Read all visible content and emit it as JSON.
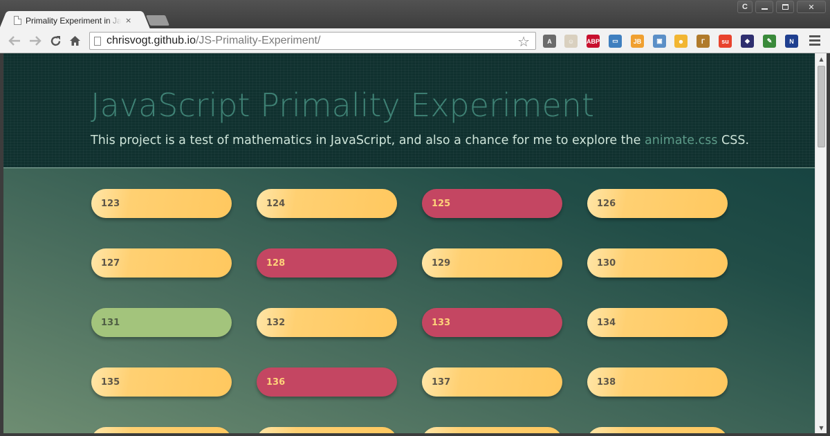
{
  "browser": {
    "tab_title": "Primality Experiment in Ja",
    "tab_close": "×",
    "url_host": "chrisvogt.github.io",
    "url_path": "/JS-Primality-Experiment/",
    "window_user": "C",
    "window_close": "✕",
    "extensions": [
      {
        "name": "angular-icon",
        "label": "A",
        "color": "#6b6b6b"
      },
      {
        "name": "face-icon",
        "label": "☺",
        "color": "#d9d0bf"
      },
      {
        "name": "adblock-icon",
        "label": "ABP",
        "color": "#c8102e"
      },
      {
        "name": "folder-icon",
        "label": "▭",
        "color": "#3f7fbf"
      },
      {
        "name": "jetbrains-icon",
        "label": "JB",
        "color": "#f0a030"
      },
      {
        "name": "window-icon",
        "label": "▣",
        "color": "#5b8fc7"
      },
      {
        "name": "emoji-icon",
        "label": "☻",
        "color": "#f2b632"
      },
      {
        "name": "ruler-icon",
        "label": "Г",
        "color": "#b07a2a"
      },
      {
        "name": "stumbleupon-icon",
        "label": "su",
        "color": "#e8432d"
      },
      {
        "name": "colorpick-icon",
        "label": "◆",
        "color": "#2f2f6f"
      },
      {
        "name": "eyedropper-icon",
        "label": "✎",
        "color": "#3a8a3a"
      },
      {
        "name": "selection-icon",
        "label": "N",
        "color": "#1f3f8f"
      }
    ]
  },
  "hero": {
    "title": "JavaScript Primality Experiment",
    "subtitle_before": "This project is a test of mathematics in JavaScript, and also a chance for me to explore the ",
    "subtitle_link": "animate.css",
    "subtitle_after": " CSS."
  },
  "colors": {
    "composite": "#ffc85f",
    "prime": "#a3c47c",
    "highlight": "#c44662"
  },
  "numbers": [
    {
      "value": "123",
      "kind": "composite"
    },
    {
      "value": "124",
      "kind": "composite"
    },
    {
      "value": "125",
      "kind": "square"
    },
    {
      "value": "126",
      "kind": "composite"
    },
    {
      "value": "127",
      "kind": "composite"
    },
    {
      "value": "128",
      "kind": "square"
    },
    {
      "value": "129",
      "kind": "composite"
    },
    {
      "value": "130",
      "kind": "composite"
    },
    {
      "value": "131",
      "kind": "prime"
    },
    {
      "value": "132",
      "kind": "composite"
    },
    {
      "value": "133",
      "kind": "square"
    },
    {
      "value": "134",
      "kind": "composite"
    },
    {
      "value": "135",
      "kind": "composite"
    },
    {
      "value": "136",
      "kind": "square"
    },
    {
      "value": "137",
      "kind": "composite"
    },
    {
      "value": "138",
      "kind": "composite"
    },
    {
      "value": "",
      "kind": "composite"
    },
    {
      "value": "",
      "kind": "composite"
    },
    {
      "value": "",
      "kind": "composite"
    },
    {
      "value": "",
      "kind": "composite"
    }
  ]
}
